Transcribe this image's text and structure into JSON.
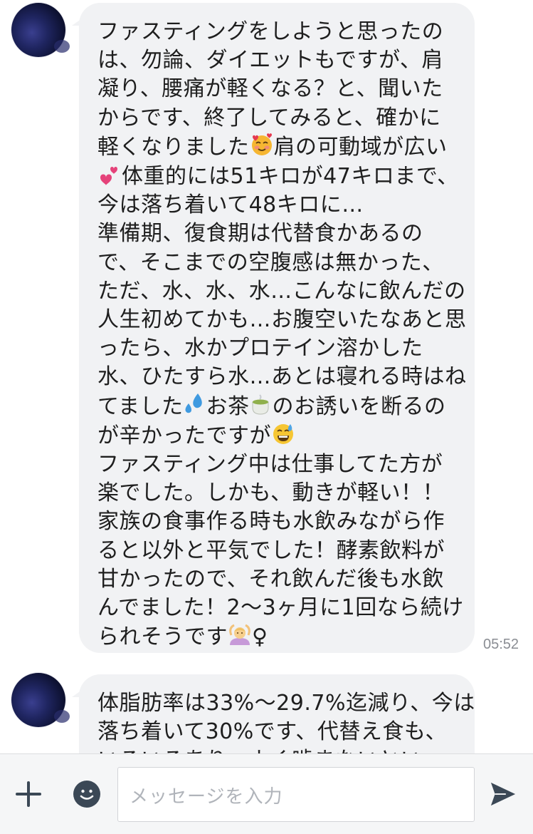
{
  "messages": [
    {
      "time": "05:52",
      "lines": [
        "ファスティングをしようと思ったの",
        "は、勿論、ダイエットもですが、肩",
        "凝り、腰痛が軽くなる？と、聞いた",
        "からです、終了してみると、確かに",
        "軽くなりました",
        "肩の可動域が広い",
        "体重的には51キロが47キロまで、",
        "今は落ち着いて48キロに…",
        "準備期、復食期は代替食かあるの",
        "で、そこまでの空腹感は無かった、",
        "ただ、水、水、水…こんなに飲んだの",
        "人生初めてかも…お腹空いたなあと思",
        "ったら、水かプロテイン溶かした",
        "水、ひたすら水…あとは寝れる時はね",
        "てました",
        "お茶",
        "のお誘いを断るの",
        "が辛かったですが",
        "ファスティング中は仕事してた方が",
        "楽でした。しかも、動きが軽い！！",
        "家族の食事作る時も水飲みながら作",
        "ると以外と平気でした！酵素飲料が",
        "甘かったので、それ飲んだ後も水飲",
        "んでました！2〜3ヶ月に1回なら続け",
        "られそうです",
        "♀"
      ]
    },
    {
      "lines": [
        "体脂肪率は33%〜29.7%迄減り、今は",
        "落ち着いて30%です、代替え食も、",
        "いろいろあり、よく噛まないとい"
      ]
    }
  ],
  "composer": {
    "placeholder": "メッセージを入力"
  },
  "icons": {
    "plus": "plus-icon",
    "sticker": "smiley-icon",
    "send": "send-icon",
    "emoji_smiling_hearts": "smiling-face-with-hearts-emoji",
    "emoji_two_hearts": "two-hearts-emoji",
    "emoji_sweat_drops": "sweat-droplets-emoji",
    "emoji_tea": "teacup-emoji",
    "emoji_sweat_smile": "grinning-sweat-emoji",
    "emoji_woman_gesturing_ok": "woman-gesturing-ok-emoji"
  },
  "colors": {
    "bubble": "#f1f2f4",
    "text": "#1e1e1e",
    "timestamp": "#8a8d93",
    "icon": "#3b4856"
  }
}
